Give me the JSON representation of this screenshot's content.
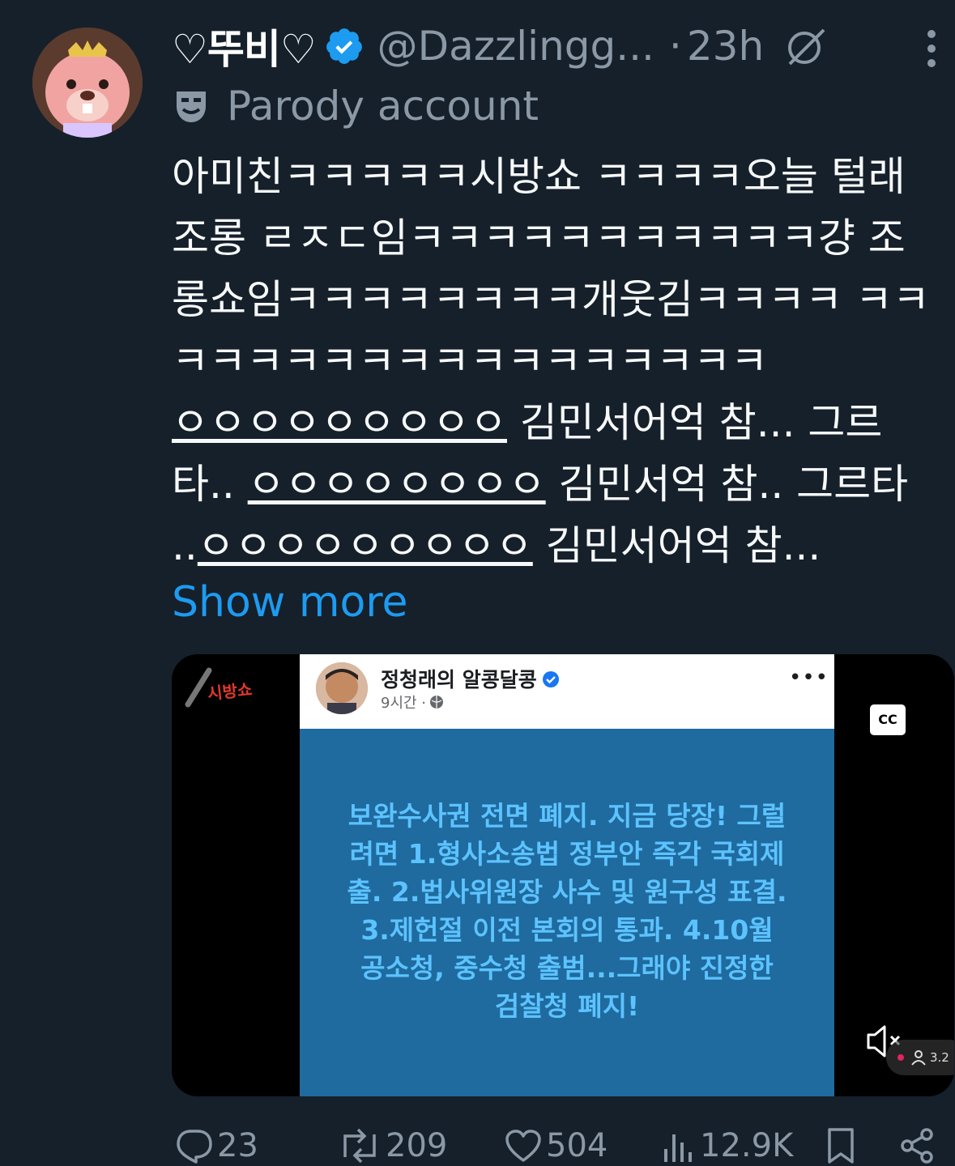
{
  "author": {
    "display_name": "♡뚜비♡",
    "handle": "@Dazzlingg...",
    "separator": "·",
    "time": "23h",
    "label": "Parody account"
  },
  "tweet": {
    "text": "아미친ㅋㅋㅋㅋㅋ시방쇼 ㅋㅋㅋㅋ오늘 털래 조롱 ㄹㅈㄷ임ㅋㅋㅋㅋㅋㅋㅋㅋㅋㅋㅋ걍 조롱쇼임ㅋㅋㅋㅋㅋㅋㅋㅋ개웃김ㅋㅋㅋㅋ ㅋㅋㅋㅋㅋㅋㅋㅋㅋㅋㅋㅋㅋㅋㅋㅋㅋㅋ",
    "line5_u": "ㅇㅇㅇㅇㅇㅇㅇㅇㅇ",
    "line5_rest": " 김민서어억 참... 그르",
    "line6_pre": "타.. ",
    "line6_u": "ㅇㅇㅇㅇㅇㅇㅇㅇ",
    "line6_rest": " 김민서억 참.. 그르",
    "line7_pre": "타 ..",
    "line7_u": "ㅇㅇㅇㅇㅇㅇㅇㅇㅇ",
    "line7_rest": " 김민서어억 참...",
    "show_more": "Show more"
  },
  "media": {
    "channel_logo": "시방쇼",
    "cc_label": "CC",
    "viewer_count": "3.2",
    "fb_post": {
      "name": "정청래의 알콩달콩",
      "time": "9시간 ·",
      "dots": "•••",
      "body_lines": [
        "보완수사권 전면 폐지. 지금 당장! 그럴",
        "려면 1.형사소송법 정부안 즉각 국회제",
        "출. 2.법사위원장 사수 및 원구성 표결.",
        "3.제헌절 이전 본회의 통과. 4.10월",
        "공소청, 중수청 출범...그래야 진정한",
        "검찰청 폐지!"
      ]
    }
  },
  "actions": {
    "replies": "23",
    "reposts": "209",
    "likes": "504",
    "views": "12.9K"
  },
  "colors": {
    "background": "#15202b",
    "muted": "#8b98a5",
    "link": "#1d9bf0",
    "verified": "#1d9bf0",
    "fb_blue": "#1f6a9e",
    "fb_text": "#5cc3ff"
  },
  "icons": [
    "verified-badge-icon",
    "grok-icon",
    "more-vertical-icon",
    "parody-mask-icon",
    "cc-icon",
    "mute-icon",
    "reply-icon",
    "repost-icon",
    "like-icon",
    "views-icon",
    "bookmark-icon",
    "share-icon"
  ]
}
